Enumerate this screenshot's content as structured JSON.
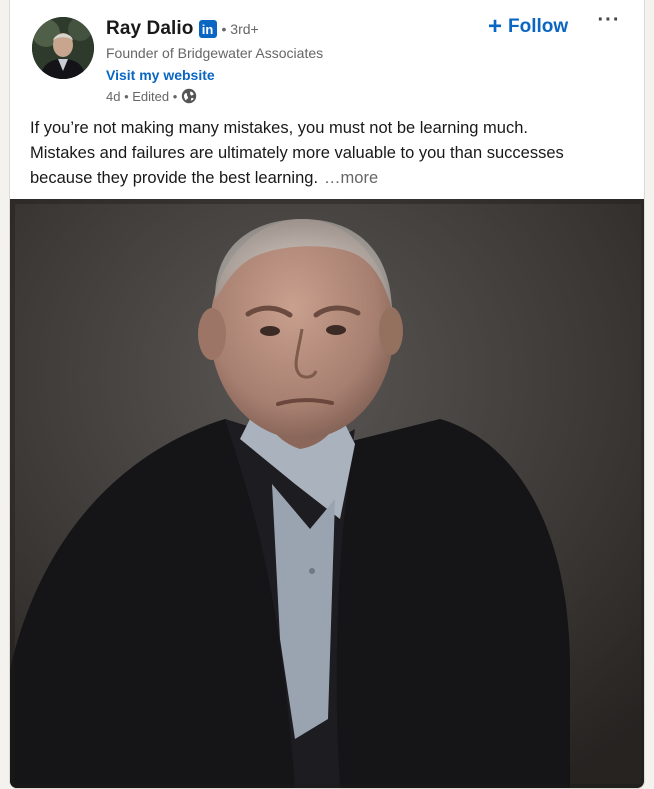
{
  "post": {
    "author": {
      "name": "Ray Dalio",
      "badge": "in",
      "degree": "• 3rd+",
      "headline": "Founder of Bridgewater Associates",
      "website_link": "Visit my website",
      "time": "4d • Edited •",
      "visibility_icon": "globe-icon"
    },
    "follow_button": {
      "icon": "plus-icon",
      "label": "Follow"
    },
    "more_menu": {
      "icon": "ellipsis-icon",
      "label": "···"
    },
    "text": {
      "lines": [
        "If you’re not making many mistakes, you must not be learning much.",
        "Mistakes and failures are ultimately more valuable to you than successes",
        "because they provide the best learning."
      ],
      "see_more": "…more"
    },
    "media": {
      "type": "video-frame",
      "subject": "portrait"
    }
  },
  "colors": {
    "brand": "#0a66c2",
    "text": "#191919",
    "muted": "#666666"
  }
}
